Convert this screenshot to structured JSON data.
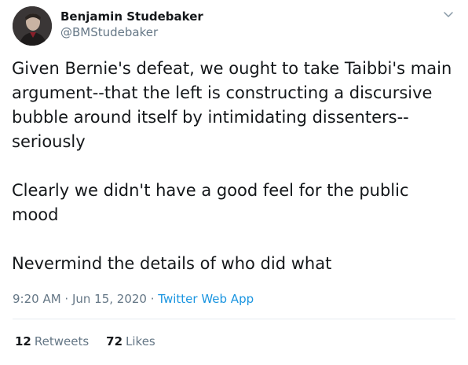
{
  "author": {
    "display_name": "Benjamin Studebaker",
    "handle": "@BMStudebaker",
    "avatar_icon": "profile-photo"
  },
  "menu_icon": "chevron-down-icon",
  "tweet": {
    "paragraphs": [
      "Given Bernie's defeat, we ought to take Taibbi's main argument--that the left is constructing a discursive bubble around itself by intimidating dissenters--seriously",
      "Clearly we didn't have a good feel for the public mood",
      "Nevermind the details of who did what"
    ]
  },
  "meta": {
    "time": "9:20 AM",
    "separator1": " · ",
    "date": "Jun 15, 2020",
    "separator2": " · ",
    "source": "Twitter Web App"
  },
  "stats": {
    "retweets_count": "12",
    "retweets_label": "Retweets",
    "likes_count": "72",
    "likes_label": "Likes"
  },
  "colors": {
    "text": "#14171a",
    "secondary": "#657786",
    "link": "#1b95e0",
    "divider": "#e6ecf0"
  }
}
